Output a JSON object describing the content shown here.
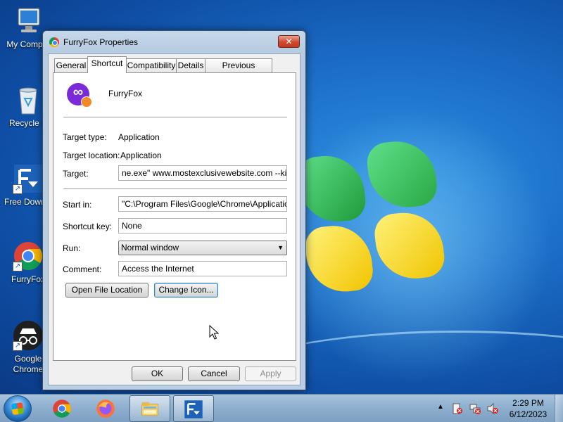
{
  "desktop": {
    "icons": [
      {
        "label": "My Comput",
        "icon": "computer-icon"
      },
      {
        "label": "Recycle B",
        "icon": "recycle-bin-icon"
      },
      {
        "label": "Free Downlo",
        "icon": "free-download-manager-icon"
      },
      {
        "label": "FurryFox",
        "icon": "chrome-icon"
      },
      {
        "label": "Google Chrome",
        "icon": "incognito-icon"
      }
    ]
  },
  "dialog": {
    "title": "FurryFox Properties",
    "close_label": "✕",
    "tabs": [
      "General",
      "Shortcut",
      "Compatibility",
      "Details",
      "Previous Versions"
    ],
    "active_tab": "Shortcut",
    "app_name": "FurryFox",
    "target_type_label": "Target type:",
    "target_type_value": "Application",
    "target_location_label": "Target location:",
    "target_location_value": "Application",
    "target_label": "Target:",
    "target_value": "ne.exe\" www.mostexclusivewebsite.com --kiosk",
    "start_in_label": "Start in:",
    "start_in_value": "\"C:\\Program Files\\Google\\Chrome\\Application\"",
    "shortcut_key_label": "Shortcut key:",
    "shortcut_key_value": "None",
    "run_label": "Run:",
    "run_value": "Normal window",
    "comment_label": "Comment:",
    "comment_value": "Access the Internet",
    "open_file_location_label": "Open File Location",
    "change_icon_label": "Change Icon...",
    "ok_label": "OK",
    "cancel_label": "Cancel",
    "apply_label": "Apply"
  },
  "taskbar": {
    "pinned": [
      "chrome-icon",
      "firefox-icon",
      "file-explorer-icon",
      "free-download-manager-icon"
    ],
    "tray_arrow": "▲",
    "clock_time": "2:29 PM",
    "clock_date": "6/12/2023"
  }
}
